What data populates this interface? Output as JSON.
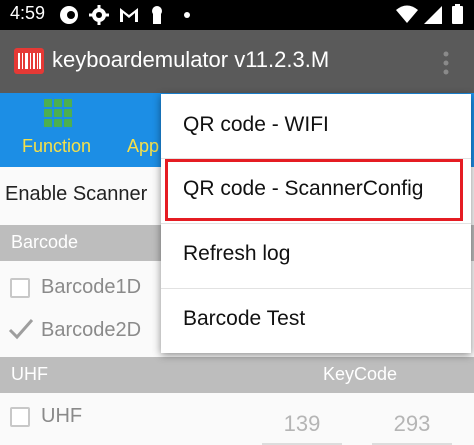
{
  "status_bar": {
    "time": "4:59",
    "icons": [
      "opera-icon",
      "gear-icon",
      "gmail-icon",
      "keyhole-icon",
      "dot-icon"
    ],
    "right_icons": [
      "wifi-icon",
      "signal-icon",
      "battery-icon"
    ]
  },
  "app_bar": {
    "title": "keyboardemulator v11.2.3.M"
  },
  "tabs": [
    {
      "label": "Function",
      "icon": "grid-icon"
    },
    {
      "label": "App"
    }
  ],
  "main": {
    "enable_scanner": "Enable Scanner",
    "sections": {
      "barcode": "Barcode",
      "uhf": "UHF",
      "keycode": "KeyCode"
    },
    "checks": [
      {
        "label": "Barcode1D",
        "checked": false
      },
      {
        "label": "Barcode2D",
        "checked": true
      },
      {
        "label": "UHF",
        "checked": false
      }
    ],
    "keycodes": [
      "139",
      "293"
    ]
  },
  "menu": {
    "items": [
      "QR code - WIFI",
      "QR code - ScannerConfig",
      "Refresh log",
      "Barcode Test"
    ],
    "highlighted_index": 1,
    "highlight_color": "#e51c23"
  },
  "colors": {
    "tabbar": "#1c8ee5",
    "tab_label": "#f5e04a",
    "appbar": "#5a5a5a"
  }
}
